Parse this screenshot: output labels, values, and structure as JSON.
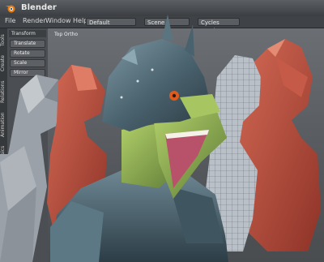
{
  "window": {
    "title": "Blender"
  },
  "menu": {
    "items": [
      "File",
      "Render",
      "Window",
      "Help"
    ]
  },
  "header": {
    "layout": "Default",
    "scene": "Scene",
    "engine": "Cycles Render"
  },
  "vertical_tabs": [
    "Tools",
    "Create",
    "Relations",
    "Animation",
    "Physics"
  ],
  "toolshelf": {
    "panel_title": "Transform",
    "buttons": [
      "Translate",
      "Rotate",
      "Scale",
      "Mirror"
    ]
  },
  "viewport": {
    "label": "Top Ortho"
  },
  "colors": {
    "clay": "#b34a3a",
    "helmet": "#4f6874",
    "skin_green": "#7fa14e",
    "wireframe": "#a9b0b8"
  }
}
